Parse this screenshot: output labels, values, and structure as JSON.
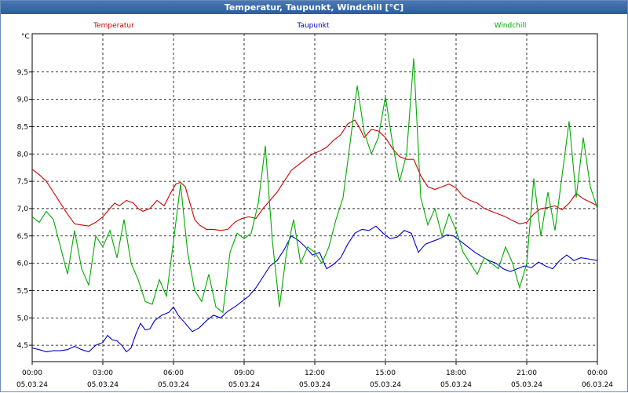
{
  "window": {
    "title": "Temperatur, Taupunkt, Windchill [°C]"
  },
  "chart_data": {
    "type": "line",
    "title": "Temperatur, Taupunkt, Windchill [°C]",
    "ylabel": "°C",
    "xlabel": "",
    "ylim": [
      4.2,
      10.2
    ],
    "xlim": [
      0,
      24
    ],
    "yticks": [
      "4,5",
      "5,0",
      "5,5",
      "6,0",
      "6,5",
      "7,0",
      "7,5",
      "8,0",
      "8,5",
      "9,0",
      "9,5"
    ],
    "xticks": [
      {
        "time": "00:00",
        "date": "05.03.24"
      },
      {
        "time": "03:00",
        "date": "05.03.24"
      },
      {
        "time": "06:00",
        "date": "05.03.24"
      },
      {
        "time": "09:00",
        "date": "05.03.24"
      },
      {
        "time": "12:00",
        "date": "05.03.24"
      },
      {
        "time": "15:00",
        "date": "05.03.24"
      },
      {
        "time": "18:00",
        "date": "05.03.24"
      },
      {
        "time": "21:00",
        "date": "05.03.24"
      },
      {
        "time": "00:00",
        "date": "06.03.24"
      }
    ],
    "grid": true,
    "legend_position": "top",
    "series": [
      {
        "name": "Temperatur",
        "color": "#cc0000",
        "points": [
          [
            0,
            7.72
          ],
          [
            0.3,
            7.62
          ],
          [
            0.6,
            7.5
          ],
          [
            0.9,
            7.3
          ],
          [
            1.2,
            7.1
          ],
          [
            1.5,
            6.9
          ],
          [
            1.8,
            6.72
          ],
          [
            2.1,
            6.7
          ],
          [
            2.4,
            6.68
          ],
          [
            2.7,
            6.75
          ],
          [
            3.0,
            6.85
          ],
          [
            3.3,
            7.0
          ],
          [
            3.5,
            7.1
          ],
          [
            3.7,
            7.05
          ],
          [
            4.0,
            7.15
          ],
          [
            4.3,
            7.1
          ],
          [
            4.5,
            7.0
          ],
          [
            4.7,
            6.95
          ],
          [
            5.0,
            7.0
          ],
          [
            5.3,
            7.15
          ],
          [
            5.6,
            7.05
          ],
          [
            5.9,
            7.3
          ],
          [
            6.1,
            7.45
          ],
          [
            6.3,
            7.48
          ],
          [
            6.5,
            7.4
          ],
          [
            6.7,
            7.1
          ],
          [
            6.9,
            6.8
          ],
          [
            7.1,
            6.7
          ],
          [
            7.4,
            6.62
          ],
          [
            7.7,
            6.62
          ],
          [
            8.0,
            6.6
          ],
          [
            8.3,
            6.62
          ],
          [
            8.6,
            6.75
          ],
          [
            8.9,
            6.82
          ],
          [
            9.2,
            6.85
          ],
          [
            9.5,
            6.82
          ],
          [
            9.8,
            7.0
          ],
          [
            10.1,
            7.15
          ],
          [
            10.4,
            7.3
          ],
          [
            10.7,
            7.5
          ],
          [
            11.0,
            7.7
          ],
          [
            11.3,
            7.8
          ],
          [
            11.6,
            7.9
          ],
          [
            11.9,
            8.0
          ],
          [
            12.2,
            8.05
          ],
          [
            12.5,
            8.12
          ],
          [
            12.8,
            8.25
          ],
          [
            13.1,
            8.35
          ],
          [
            13.4,
            8.55
          ],
          [
            13.7,
            8.62
          ],
          [
            13.9,
            8.48
          ],
          [
            14.1,
            8.3
          ],
          [
            14.4,
            8.45
          ],
          [
            14.7,
            8.42
          ],
          [
            15.0,
            8.3
          ],
          [
            15.3,
            8.1
          ],
          [
            15.6,
            7.95
          ],
          [
            15.9,
            7.9
          ],
          [
            16.2,
            7.9
          ],
          [
            16.5,
            7.6
          ],
          [
            16.8,
            7.4
          ],
          [
            17.1,
            7.35
          ],
          [
            17.4,
            7.4
          ],
          [
            17.7,
            7.45
          ],
          [
            18.0,
            7.38
          ],
          [
            18.3,
            7.22
          ],
          [
            18.6,
            7.15
          ],
          [
            18.9,
            7.1
          ],
          [
            19.2,
            7.0
          ],
          [
            19.5,
            6.95
          ],
          [
            19.8,
            6.9
          ],
          [
            20.1,
            6.85
          ],
          [
            20.4,
            6.78
          ],
          [
            20.7,
            6.72
          ],
          [
            21.0,
            6.75
          ],
          [
            21.3,
            6.9
          ],
          [
            21.6,
            7.0
          ],
          [
            21.9,
            7.02
          ],
          [
            22.2,
            7.05
          ],
          [
            22.5,
            6.98
          ],
          [
            22.8,
            7.1
          ],
          [
            23.1,
            7.28
          ],
          [
            23.4,
            7.18
          ],
          [
            23.7,
            7.12
          ],
          [
            24.0,
            7.05
          ]
        ]
      },
      {
        "name": "Taupunkt",
        "color": "#0000cc",
        "points": [
          [
            0,
            4.45
          ],
          [
            0.3,
            4.42
          ],
          [
            0.6,
            4.38
          ],
          [
            0.9,
            4.4
          ],
          [
            1.2,
            4.4
          ],
          [
            1.5,
            4.42
          ],
          [
            1.8,
            4.48
          ],
          [
            2.1,
            4.42
          ],
          [
            2.4,
            4.38
          ],
          [
            2.7,
            4.5
          ],
          [
            3.0,
            4.55
          ],
          [
            3.2,
            4.68
          ],
          [
            3.4,
            4.6
          ],
          [
            3.6,
            4.58
          ],
          [
            3.8,
            4.5
          ],
          [
            4.0,
            4.38
          ],
          [
            4.2,
            4.45
          ],
          [
            4.4,
            4.7
          ],
          [
            4.6,
            4.9
          ],
          [
            4.8,
            4.78
          ],
          [
            5.0,
            4.8
          ],
          [
            5.2,
            4.95
          ],
          [
            5.5,
            5.05
          ],
          [
            5.8,
            5.1
          ],
          [
            6.0,
            5.2
          ],
          [
            6.2,
            5.05
          ],
          [
            6.5,
            4.9
          ],
          [
            6.8,
            4.75
          ],
          [
            7.1,
            4.82
          ],
          [
            7.4,
            4.95
          ],
          [
            7.7,
            5.05
          ],
          [
            8.0,
            5.0
          ],
          [
            8.3,
            5.12
          ],
          [
            8.6,
            5.2
          ],
          [
            8.9,
            5.3
          ],
          [
            9.2,
            5.4
          ],
          [
            9.5,
            5.55
          ],
          [
            9.8,
            5.75
          ],
          [
            10.1,
            5.95
          ],
          [
            10.4,
            6.05
          ],
          [
            10.7,
            6.25
          ],
          [
            11.0,
            6.5
          ],
          [
            11.3,
            6.42
          ],
          [
            11.6,
            6.3
          ],
          [
            11.9,
            6.15
          ],
          [
            12.2,
            6.2
          ],
          [
            12.5,
            5.9
          ],
          [
            12.8,
            5.98
          ],
          [
            13.1,
            6.1
          ],
          [
            13.4,
            6.35
          ],
          [
            13.7,
            6.55
          ],
          [
            14.0,
            6.62
          ],
          [
            14.3,
            6.6
          ],
          [
            14.6,
            6.68
          ],
          [
            14.9,
            6.55
          ],
          [
            15.2,
            6.45
          ],
          [
            15.5,
            6.48
          ],
          [
            15.8,
            6.6
          ],
          [
            16.1,
            6.55
          ],
          [
            16.4,
            6.2
          ],
          [
            16.7,
            6.35
          ],
          [
            17.0,
            6.4
          ],
          [
            17.3,
            6.45
          ],
          [
            17.6,
            6.52
          ],
          [
            17.9,
            6.5
          ],
          [
            18.2,
            6.4
          ],
          [
            18.5,
            6.3
          ],
          [
            18.8,
            6.2
          ],
          [
            19.1,
            6.12
          ],
          [
            19.4,
            6.05
          ],
          [
            19.7,
            6.0
          ],
          [
            20.0,
            5.9
          ],
          [
            20.3,
            5.85
          ],
          [
            20.6,
            5.9
          ],
          [
            20.9,
            5.95
          ],
          [
            21.2,
            5.92
          ],
          [
            21.5,
            6.02
          ],
          [
            21.8,
            5.95
          ],
          [
            22.1,
            5.9
          ],
          [
            22.4,
            6.05
          ],
          [
            22.7,
            6.15
          ],
          [
            23.0,
            6.05
          ],
          [
            23.3,
            6.1
          ],
          [
            23.6,
            6.08
          ],
          [
            24.0,
            6.05
          ]
        ]
      },
      {
        "name": "Windchill",
        "color": "#00aa00",
        "points": [
          [
            0,
            6.85
          ],
          [
            0.3,
            6.75
          ],
          [
            0.6,
            6.95
          ],
          [
            0.9,
            6.8
          ],
          [
            1.2,
            6.3
          ],
          [
            1.5,
            5.8
          ],
          [
            1.8,
            6.6
          ],
          [
            2.1,
            5.9
          ],
          [
            2.4,
            5.6
          ],
          [
            2.7,
            6.5
          ],
          [
            3.0,
            6.3
          ],
          [
            3.3,
            6.6
          ],
          [
            3.6,
            6.1
          ],
          [
            3.9,
            6.8
          ],
          [
            4.2,
            6.0
          ],
          [
            4.5,
            5.7
          ],
          [
            4.8,
            5.3
          ],
          [
            5.1,
            5.25
          ],
          [
            5.4,
            5.7
          ],
          [
            5.7,
            5.4
          ],
          [
            6.0,
            6.4
          ],
          [
            6.3,
            7.45
          ],
          [
            6.6,
            6.2
          ],
          [
            6.9,
            5.5
          ],
          [
            7.2,
            5.3
          ],
          [
            7.5,
            5.8
          ],
          [
            7.8,
            5.2
          ],
          [
            8.1,
            5.1
          ],
          [
            8.4,
            6.2
          ],
          [
            8.7,
            6.55
          ],
          [
            9.0,
            6.45
          ],
          [
            9.3,
            6.55
          ],
          [
            9.6,
            7.1
          ],
          [
            9.9,
            8.15
          ],
          [
            10.2,
            6.4
          ],
          [
            10.5,
            5.2
          ],
          [
            10.8,
            6.2
          ],
          [
            11.1,
            6.8
          ],
          [
            11.4,
            6.0
          ],
          [
            11.7,
            6.3
          ],
          [
            12.0,
            6.2
          ],
          [
            12.3,
            6.0
          ],
          [
            12.6,
            6.3
          ],
          [
            12.9,
            6.8
          ],
          [
            13.2,
            7.2
          ],
          [
            13.5,
            8.2
          ],
          [
            13.8,
            9.25
          ],
          [
            14.1,
            8.4
          ],
          [
            14.4,
            8.0
          ],
          [
            14.7,
            8.3
          ],
          [
            15.0,
            9.05
          ],
          [
            15.3,
            8.2
          ],
          [
            15.6,
            7.5
          ],
          [
            15.9,
            8.0
          ],
          [
            16.2,
            9.75
          ],
          [
            16.5,
            7.2
          ],
          [
            16.8,
            6.7
          ],
          [
            17.1,
            7.0
          ],
          [
            17.4,
            6.5
          ],
          [
            17.7,
            6.9
          ],
          [
            18.0,
            6.6
          ],
          [
            18.3,
            6.2
          ],
          [
            18.6,
            6.0
          ],
          [
            18.9,
            5.8
          ],
          [
            19.2,
            6.1
          ],
          [
            19.5,
            6.0
          ],
          [
            19.8,
            5.9
          ],
          [
            20.1,
            6.3
          ],
          [
            20.4,
            6.0
          ],
          [
            20.7,
            5.55
          ],
          [
            21.0,
            6.0
          ],
          [
            21.3,
            7.55
          ],
          [
            21.6,
            6.5
          ],
          [
            21.9,
            7.3
          ],
          [
            22.2,
            6.6
          ],
          [
            22.5,
            7.6
          ],
          [
            22.8,
            8.6
          ],
          [
            23.1,
            7.2
          ],
          [
            23.4,
            8.3
          ],
          [
            23.7,
            7.4
          ],
          [
            24.0,
            7.0
          ]
        ]
      }
    ]
  }
}
